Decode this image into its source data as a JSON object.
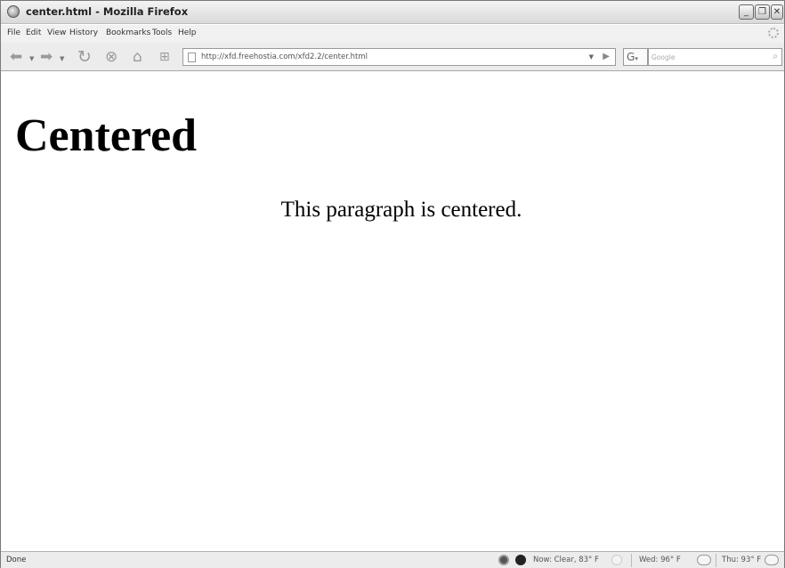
{
  "window": {
    "title": "center.html - Mozilla Firefox"
  },
  "menu": [
    "File",
    "Edit",
    "View",
    "History",
    "Bookmarks",
    "Tools",
    "Help"
  ],
  "toolbar": {
    "url": "http://xfd.freehostia.com/xfd2.2/center.html",
    "search_placeholder": "Google"
  },
  "page": {
    "heading": "Centered",
    "paragraph": "This paragraph is centered."
  },
  "status": {
    "text": "Done",
    "weather_now": "Now: Clear, 83° F",
    "weather_wed": "Wed: 96° F",
    "weather_thu": "Thu: 93° F"
  }
}
